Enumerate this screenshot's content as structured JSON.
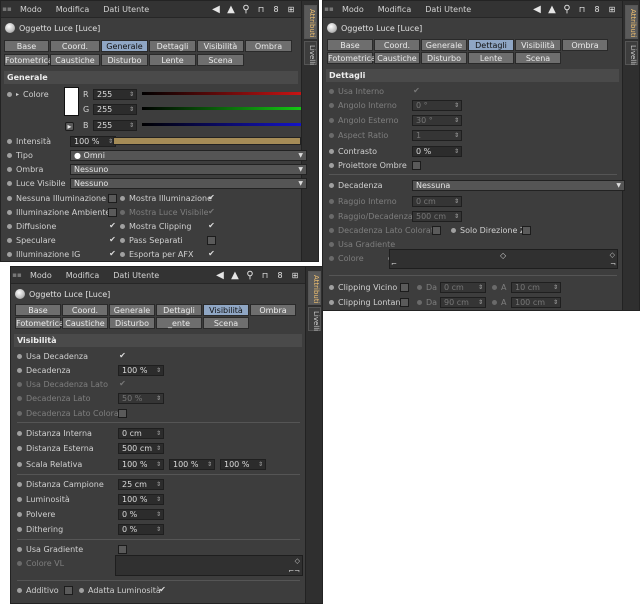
{
  "menu": {
    "modo": "Modo",
    "modifica": "Modifica",
    "dati_utente": "Dati Utente"
  },
  "side_tabs": {
    "attributi": "Attributi",
    "livelli": "Livelli"
  },
  "object_name": "Oggetto Luce [Luce]",
  "tabs": {
    "row1": [
      "Base",
      "Coord.",
      "Generale",
      "Dettagli",
      "Visibilità",
      "Ombra"
    ],
    "row2": [
      "Fotometrica",
      "Caustiche",
      "Disturbo",
      "Lente",
      "Scena"
    ],
    "row2_visibility_panel": [
      "Fotometrica",
      "Caustiche",
      "Disturbo",
      "_ente",
      "Scena"
    ]
  },
  "generale": {
    "title": "Generale",
    "colore_label": "Colore",
    "r_label": "R",
    "g_label": "G",
    "b_label": "B",
    "r": "255",
    "g": "255",
    "b": "255",
    "intensita_label": "Intensità",
    "intensita": "100 %",
    "intensita_fraction": 1.0,
    "tipo_label": "Tipo",
    "tipo": "Omni",
    "ombra_label": "Ombra",
    "ombra": "Nessuno",
    "luce_visibile_label": "Luce Visibile",
    "luce_visibile": "Nessuno",
    "nessuna_illum": "Nessuna Illuminazione",
    "mostra_illum": "Mostra Illuminazione",
    "illum_ambiente": "Illuminazione Ambiente",
    "mostra_luce_vis": "Mostra Luce Visibile",
    "diffusione": "Diffusione",
    "mostra_clipping": "Mostra Clipping",
    "speculare": "Speculare",
    "pass_separati": "Pass Separati",
    "illum_ig": "Illuminazione IG",
    "esporta_afx": "Esporta per AFX",
    "colors": {
      "red": "#c81414",
      "green": "#14c814",
      "blue": "#1414c8"
    }
  },
  "dettagli": {
    "title": "Dettagli",
    "usa_interno": "Usa Interno",
    "angolo_interno": "Angolo Interno",
    "angolo_interno_val": "0 °",
    "angolo_esterno": "Angolo Esterno",
    "angolo_esterno_val": "30 °",
    "aspect_ratio": "Aspect Ratio",
    "aspect_ratio_val": "1",
    "contrasto": "Contrasto",
    "contrasto_val": "0 %",
    "proiettore_ombre": "Proiettore Ombre",
    "decadenza": "Decadenza",
    "decadenza_val": "Nessuna",
    "raggio_interno": "Raggio Interno",
    "raggio_interno_val": "0 cm",
    "raggio_decadenza": "Raggio/Decadenza",
    "raggio_decadenza_val": "500 cm",
    "decadenza_lato_colorata": "Decadenza Lato Colorata",
    "solo_direzione_z": "Solo Direzione Z",
    "usa_gradiente": "Usa Gradiente",
    "colore": "Colore",
    "clipping_vicino": "Clipping Vicino",
    "clipping_lontano": "Clipping Lontano",
    "da": "Da",
    "a": "A",
    "cv_da": "0 cm",
    "cv_a": "10 cm",
    "cl_da": "90 cm",
    "cl_a": "100 cm"
  },
  "visibilita": {
    "title": "Visibilità",
    "usa_decadenza": "Usa Decadenza",
    "decadenza": "Decadenza",
    "decadenza_val": "100 %",
    "usa_decadenza_lato": "Usa Decadenza Lato",
    "decadenza_lato": "Decadenza Lato",
    "decadenza_lato_val": "50 %",
    "decadenza_lato_colorata": "Decadenza Lato Colorata",
    "distanza_interna": "Distanza Interna",
    "distanza_interna_val": "0 cm",
    "distanza_esterna": "Distanza Esterna",
    "distanza_esterna_val": "500 cm",
    "scala_relativa": "Scala Relativa",
    "scala_x": "100 %",
    "scala_y": "100 %",
    "scala_z": "100 %",
    "distanza_campione": "Distanza Campione",
    "distanza_campione_val": "25 cm",
    "luminosita": "Luminosità",
    "luminosita_val": "100 %",
    "polvere": "Polvere",
    "polvere_val": "0 %",
    "dithering": "Dithering",
    "dithering_val": "0 %",
    "usa_gradiente": "Usa Gradiente",
    "colore_vl": "Colore VL",
    "additivo": "Additivo",
    "adatta_luminosita": "Adatta Luminosità"
  }
}
